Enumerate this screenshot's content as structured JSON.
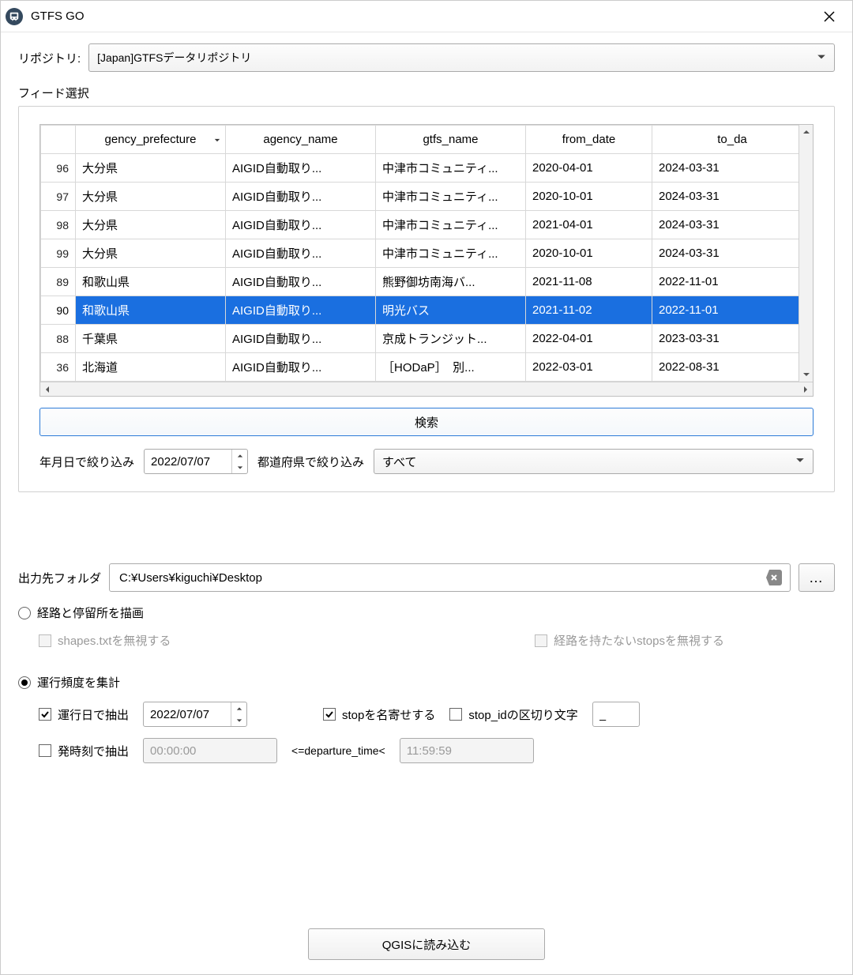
{
  "window": {
    "title": "GTFS GO"
  },
  "repository": {
    "label": "リポジトリ:",
    "value": "[Japan]GTFSデータリポジトリ"
  },
  "feed": {
    "section_label": "フィード選択",
    "columns": [
      "gency_prefecture",
      "agency_name",
      "gtfs_name",
      "from_date",
      "to_da"
    ],
    "sorted_column_index": 0,
    "rows": [
      {
        "rownum": "96",
        "cells": [
          "大分県",
          "AIGID自動取り...",
          "中津市コミュニティ...",
          "2020-04-01",
          "2024-03-31"
        ],
        "selected": false
      },
      {
        "rownum": "97",
        "cells": [
          "大分県",
          "AIGID自動取り...",
          "中津市コミュニティ...",
          "2020-10-01",
          "2024-03-31"
        ],
        "selected": false
      },
      {
        "rownum": "98",
        "cells": [
          "大分県",
          "AIGID自動取り...",
          "中津市コミュニティ...",
          "2021-04-01",
          "2024-03-31"
        ],
        "selected": false
      },
      {
        "rownum": "99",
        "cells": [
          "大分県",
          "AIGID自動取り...",
          "中津市コミュニティ...",
          "2020-10-01",
          "2024-03-31"
        ],
        "selected": false
      },
      {
        "rownum": "89",
        "cells": [
          "和歌山県",
          "AIGID自動取り...",
          "熊野御坊南海バ...",
          "2021-11-08",
          "2022-11-01"
        ],
        "selected": false
      },
      {
        "rownum": "90",
        "cells": [
          "和歌山県",
          "AIGID自動取り...",
          "明光バス",
          "2021-11-02",
          "2022-11-01"
        ],
        "selected": true
      },
      {
        "rownum": "88",
        "cells": [
          "千葉県",
          "AIGID自動取り...",
          "京成トランジット...",
          "2022-04-01",
          "2023-03-31"
        ],
        "selected": false
      },
      {
        "rownum": "36",
        "cells": [
          "北海道",
          "AIGID自動取り...",
          "［HODaP］　別...",
          "2022-03-01",
          "2022-08-31"
        ],
        "selected": false
      }
    ],
    "search_button": "検索",
    "date_filter_label": "年月日で絞り込み",
    "date_filter_value": "2022/07/07",
    "pref_filter_label": "都道府県で絞り込み",
    "pref_filter_value": "すべて"
  },
  "output": {
    "label": "出力先フォルダ",
    "value": "C:¥Users¥kiguchi¥Desktop",
    "browse": "…"
  },
  "options": {
    "radio_draw": "経路と停留所を描画",
    "cb_ignore_shapes": "shapes.txtを無視する",
    "cb_ignore_stops": "経路を持たないstopsを無視する",
    "radio_freq": "運行頻度を集計",
    "cb_filter_by_date": "運行日で抽出",
    "freq_date_value": "2022/07/07",
    "cb_merge_stops": "stopを名寄せする",
    "cb_stopid_delim": "stop_idの区切り文字",
    "stopid_delim_value": "_",
    "cb_filter_by_time": "発時刻で抽出",
    "time_from": "00:00:00",
    "time_cond": "<=departure_time<",
    "time_to": "11:59:59"
  },
  "footer": {
    "load_button": "QGISに読み込む"
  }
}
